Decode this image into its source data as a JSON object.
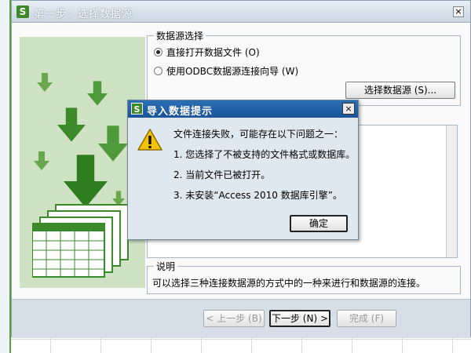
{
  "wizard": {
    "logo_letter": "S",
    "title": "第一步：选择数据源",
    "close_glyph": "×",
    "source_group": {
      "legend": "数据源选择",
      "option_file": "直接打开数据文件 (O)",
      "option_odbc": "使用ODBC数据源连接向导 (W)",
      "select_button": "选择数据源 (S)..."
    },
    "description": {
      "legend": "说明",
      "text": "可以选择三种连接数据源的方式中的一种来进行和数据源的连接。"
    },
    "footer": {
      "prev": "< 上一步 (B)",
      "next": "下一步 (N) >",
      "finish": "完成 (F)"
    }
  },
  "dialog": {
    "logo_letter": "S",
    "title": "导入数据提示",
    "close_glyph": "×",
    "message_intro": "文件连接失败，可能存在以下问题之一：",
    "reasons": [
      "1. 您选择了不被支持的文件格式或数据库。",
      "2. 当前文件已被打开。",
      "3. 未安装“Access 2010 数据库引擎”。"
    ],
    "ok_button": "确定"
  },
  "colors": {
    "accent_green": "#3d8a2a",
    "illustration_bg": "#cfe3c4",
    "dialog_title_blue": "#1b5499"
  }
}
